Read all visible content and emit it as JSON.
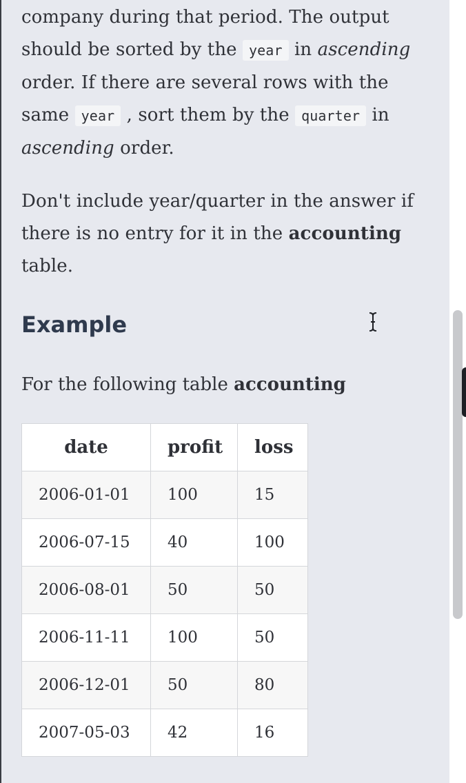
{
  "description": {
    "p1": {
      "t1": "company during that period. The output should be sorted by the ",
      "code_year": "year",
      "t2": " in ",
      "em_ascending": "ascending",
      "t3": " order. If there are several rows with the same ",
      "code_year_2": "year",
      "t4": " , sort them by the ",
      "code_quarter": "quarter",
      "t5": " in ",
      "em_ascending_2": "ascending",
      "t6": " order."
    },
    "p2": {
      "t1": "Don't include year/quarter in the answer if there is no entry for it in the ",
      "bold_table": "accounting",
      "t2": " table."
    }
  },
  "example": {
    "heading": "Example",
    "intro_text": "For the following table ",
    "intro_bold": "accounting"
  },
  "table": {
    "headers": [
      "date",
      "profit",
      "loss"
    ],
    "rows": [
      [
        "2006-01-01",
        "100",
        "15"
      ],
      [
        "2006-07-15",
        "40",
        "100"
      ],
      [
        "2006-08-01",
        "50",
        "50"
      ],
      [
        "2006-11-11",
        "100",
        "50"
      ],
      [
        "2006-12-01",
        "50",
        "80"
      ],
      [
        "2007-05-03",
        "42",
        "16"
      ]
    ]
  },
  "icons": {
    "cursor": "text-cursor-icon"
  },
  "colors": {
    "background": "#e7e9ef",
    "heading": "#2f3a4d",
    "text": "#2f3137",
    "code_bg": "#f4f5f7",
    "scrollbar_thumb": "#c8c9cc"
  }
}
